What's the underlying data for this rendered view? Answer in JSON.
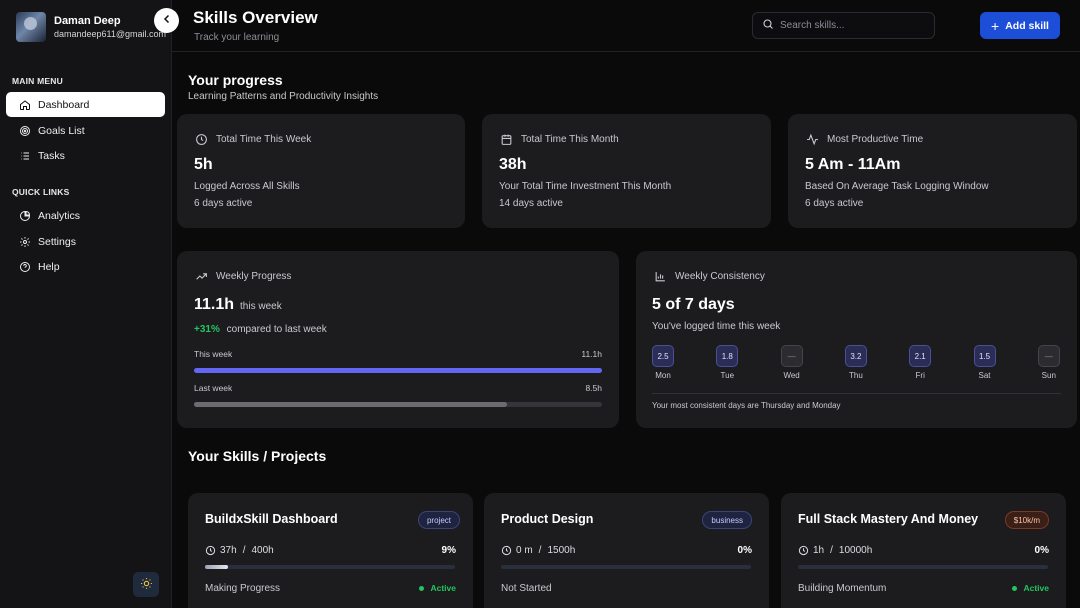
{
  "user": {
    "name": "Daman Deep",
    "email": "damandeep611@gmail.com"
  },
  "sidebar": {
    "main_heading": "MAIN MENU",
    "main_items": [
      {
        "label": "Dashboard",
        "icon": "home-icon"
      },
      {
        "label": "Goals List",
        "icon": "target-icon"
      },
      {
        "label": "Tasks",
        "icon": "list-icon"
      }
    ],
    "quick_heading": "QUICK LINKS",
    "quick_items": [
      {
        "label": "Analytics",
        "icon": "pie-chart-icon"
      },
      {
        "label": "Settings",
        "icon": "gear-icon"
      },
      {
        "label": "Help",
        "icon": "help-icon"
      }
    ]
  },
  "header": {
    "title": "Skills Overview",
    "subtitle": "Track your learning",
    "search_placeholder": "Search skills...",
    "add_label": "Add skill"
  },
  "progress": {
    "title": "Your progress",
    "subtitle": "Learning Patterns and Productivity Insights",
    "stats": [
      {
        "label": "Total Time This Week",
        "value": "5h",
        "desc": "Logged Across All Skills",
        "meta": "6 days active",
        "icon": "clock-icon"
      },
      {
        "label": "Total Time This Month",
        "value": "38h",
        "desc": "Your Total Time Investment This Month",
        "meta": "14 days active",
        "icon": "calendar-icon"
      },
      {
        "label": "Most Productive Time",
        "value": "5 Am - 11Am",
        "desc": "Based On Average Task Logging Window",
        "meta": "6 days active",
        "icon": "activity-icon"
      }
    ]
  },
  "weekly_progress": {
    "label": "Weekly Progress",
    "value": "11.1h",
    "value_suffix": "this week",
    "change": "+31%",
    "change_text": "compared to last week",
    "this_week_label": "This week",
    "this_week_value": "11.1h",
    "this_week_fraction": 1.0,
    "last_week_label": "Last week",
    "last_week_value": "8.5h",
    "last_week_fraction": 0.766,
    "accent": "#6366f1"
  },
  "consistency": {
    "label": "Weekly Consistency",
    "value": "5 of 7 days",
    "subtitle": "You've logged time this week",
    "days": [
      {
        "name": "Mon",
        "value": "2.5",
        "active": true
      },
      {
        "name": "Tue",
        "value": "1.8",
        "active": true
      },
      {
        "name": "Wed",
        "value": "—",
        "active": false
      },
      {
        "name": "Thu",
        "value": "3.2",
        "active": true
      },
      {
        "name": "Fri",
        "value": "2.1",
        "active": true
      },
      {
        "name": "Sat",
        "value": "1.5",
        "active": true
      },
      {
        "name": "Sun",
        "value": "—",
        "active": false
      }
    ],
    "note": "Your most consistent days are Thursday and Monday"
  },
  "skills": {
    "title": "Your Skills / Projects",
    "items": [
      {
        "title": "BuildxSkill Dashboard",
        "tag": "project",
        "tag_style": "blue",
        "time": "37h",
        "target": "400h",
        "pct": "9%",
        "fraction": 0.09,
        "status": "Making Progress",
        "active_label": "Active",
        "active": true
      },
      {
        "title": "Product Design",
        "tag": "business",
        "tag_style": "blue",
        "time": "0 m",
        "target": "1500h",
        "pct": "0%",
        "fraction": 0,
        "status": "Not Started",
        "active_label": "",
        "active": false
      },
      {
        "title": "Full Stack Mastery And Money",
        "tag": "$10k/m",
        "tag_style": "orange",
        "time": "1h",
        "target": "10000h",
        "pct": "0%",
        "fraction": 0,
        "status": "Building Momentum",
        "active_label": "Active",
        "active": true
      }
    ]
  }
}
